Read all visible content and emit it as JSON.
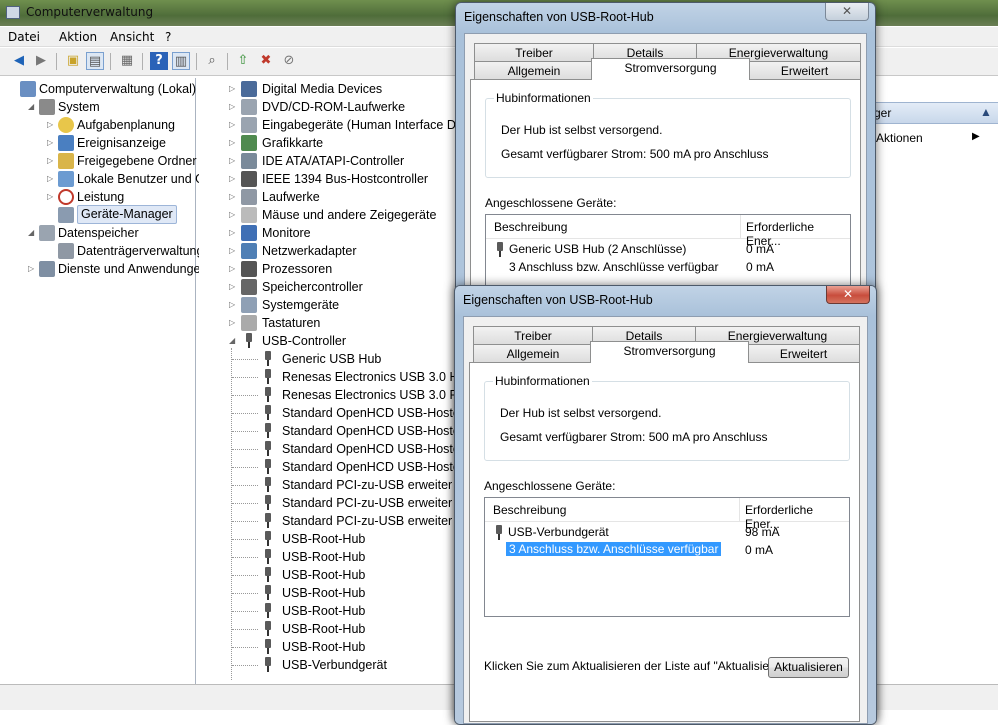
{
  "main": {
    "title": "Computerverwaltung",
    "menu": [
      "Datei",
      "Aktion",
      "Ansicht",
      "?"
    ],
    "left_tree": [
      {
        "label": "Computerverwaltung (Lokal)",
        "icon": "computer-icon",
        "indent": 0,
        "arrow": ""
      },
      {
        "label": "System",
        "icon": "tools-icon",
        "indent": 1,
        "arrow": "open"
      },
      {
        "label": "Aufgabenplanung",
        "icon": "clock-icon",
        "indent": 2,
        "arrow": "closed"
      },
      {
        "label": "Ereignisanzeige",
        "icon": "event-viewer-icon",
        "indent": 2,
        "arrow": "closed"
      },
      {
        "label": "Freigegebene Ordner",
        "icon": "shared-folder-icon",
        "indent": 2,
        "arrow": "closed"
      },
      {
        "label": "Lokale Benutzer und Gr",
        "icon": "users-icon",
        "indent": 2,
        "arrow": "closed"
      },
      {
        "label": "Leistung",
        "icon": "performance-icon",
        "indent": 2,
        "arrow": "closed"
      },
      {
        "label": "Geräte-Manager",
        "icon": "device-manager-icon",
        "indent": 2,
        "arrow": "",
        "selected": true
      },
      {
        "label": "Datenspeicher",
        "icon": "storage-icon",
        "indent": 1,
        "arrow": "open"
      },
      {
        "label": "Datenträgerverwaltung",
        "icon": "disk-icon",
        "indent": 2,
        "arrow": ""
      },
      {
        "label": "Dienste und Anwendungen",
        "icon": "services-icon",
        "indent": 1,
        "arrow": "closed"
      }
    ],
    "device_tree": [
      {
        "label": "Digital Media Devices",
        "icon": "media-icon",
        "indent": 0
      },
      {
        "label": "DVD/CD-ROM-Laufwerke",
        "icon": "dvd-icon",
        "indent": 0
      },
      {
        "label": "Eingabegeräte (Human Interface Devi",
        "icon": "hid-icon",
        "indent": 0
      },
      {
        "label": "Grafikkarte",
        "icon": "display-adapter-icon",
        "indent": 0
      },
      {
        "label": "IDE ATA/ATAPI-Controller",
        "icon": "ide-icon",
        "indent": 0
      },
      {
        "label": "IEEE 1394 Bus-Hostcontroller",
        "icon": "firewire-icon",
        "indent": 0
      },
      {
        "label": "Laufwerke",
        "icon": "drive-icon",
        "indent": 0
      },
      {
        "label": "Mäuse und andere Zeigegeräte",
        "icon": "mouse-icon",
        "indent": 0
      },
      {
        "label": "Monitore",
        "icon": "monitor-icon",
        "indent": 0
      },
      {
        "label": "Netzwerkadapter",
        "icon": "network-icon",
        "indent": 0
      },
      {
        "label": "Prozessoren",
        "icon": "cpu-icon",
        "indent": 0
      },
      {
        "label": "Speichercontroller",
        "icon": "storage-controller-icon",
        "indent": 0
      },
      {
        "label": "Systemgeräte",
        "icon": "system-device-icon",
        "indent": 0
      },
      {
        "label": "Tastaturen",
        "icon": "keyboard-icon",
        "indent": 0
      },
      {
        "label": "USB-Controller",
        "icon": "usb-icon",
        "indent": 0,
        "open": true
      },
      {
        "label": "Generic USB Hub",
        "icon": "usb-icon",
        "indent": 1
      },
      {
        "label": "Renesas Electronics USB 3.0 Host",
        "icon": "usb-icon",
        "indent": 1
      },
      {
        "label": "Renesas Electronics USB 3.0 Root",
        "icon": "usb-icon",
        "indent": 1
      },
      {
        "label": "Standard OpenHCD USB-Hostco",
        "icon": "usb-icon",
        "indent": 1
      },
      {
        "label": "Standard OpenHCD USB-Hostco",
        "icon": "usb-icon",
        "indent": 1
      },
      {
        "label": "Standard OpenHCD USB-Hostco",
        "icon": "usb-icon",
        "indent": 1
      },
      {
        "label": "Standard OpenHCD USB-Hostco",
        "icon": "usb-icon",
        "indent": 1
      },
      {
        "label": "Standard PCI-zu-USB erweiter",
        "icon": "usb-icon",
        "indent": 1
      },
      {
        "label": "Standard PCI-zu-USB erweiter",
        "icon": "usb-icon",
        "indent": 1
      },
      {
        "label": "Standard PCI-zu-USB erweiter",
        "icon": "usb-icon",
        "indent": 1
      },
      {
        "label": "USB-Root-Hub",
        "icon": "usb-icon",
        "indent": 1
      },
      {
        "label": "USB-Root-Hub",
        "icon": "usb-icon",
        "indent": 1
      },
      {
        "label": "USB-Root-Hub",
        "icon": "usb-icon",
        "indent": 1
      },
      {
        "label": "USB-Root-Hub",
        "icon": "usb-icon",
        "indent": 1
      },
      {
        "label": "USB-Root-Hub",
        "icon": "usb-icon",
        "indent": 1
      },
      {
        "label": "USB-Root-Hub",
        "icon": "usb-icon",
        "indent": 1
      },
      {
        "label": "USB-Root-Hub",
        "icon": "usb-icon",
        "indent": 1
      },
      {
        "label": "USB-Verbundgerät",
        "icon": "usb-icon",
        "indent": 1
      }
    ],
    "actions": {
      "header": "ger",
      "item": "Aktionen"
    }
  },
  "dialog1": {
    "title": "Eigenschaften von USB-Root-Hub",
    "tabs_back": [
      "Treiber",
      "Details",
      "Energieverwaltung"
    ],
    "tabs_front": [
      "Allgemein",
      "Stromversorgung",
      "Erweitert"
    ],
    "hub_group": "Hubinformationen",
    "hub_line1": "Der Hub ist selbst versorgend.",
    "hub_line2": "Gesamt verfügbarer Strom: 500 mA pro Anschluss",
    "devices_label": "Angeschlossene Geräte:",
    "col1": "Beschreibung",
    "col2": "Erforderliche Ener...",
    "rows": [
      {
        "desc": "Generic USB Hub (2 Anschlüsse)",
        "power": "0 mA",
        "icon": true
      },
      {
        "desc": "3 Anschluss bzw. Anschlüsse verfügbar",
        "power": "0 mA",
        "icon": false
      }
    ]
  },
  "dialog2": {
    "title": "Eigenschaften von USB-Root-Hub",
    "tabs_back": [
      "Treiber",
      "Details",
      "Energieverwaltung"
    ],
    "tabs_front": [
      "Allgemein",
      "Stromversorgung",
      "Erweitert"
    ],
    "hub_group": "Hubinformationen",
    "hub_line1": "Der Hub ist selbst versorgend.",
    "hub_line2": "Gesamt verfügbarer Strom: 500 mA pro Anschluss",
    "devices_label": "Angeschlossene Geräte:",
    "col1": "Beschreibung",
    "col2": "Erforderliche Ener...",
    "rows": [
      {
        "desc": "USB-Verbundgerät",
        "power": "98 mA",
        "icon": true
      },
      {
        "desc": "3 Anschluss bzw. Anschlüsse verfügbar",
        "power": "0 mA",
        "icon": false,
        "selected": true
      }
    ],
    "refresh_hint": "Klicken Sie zum Aktualisieren der Liste auf \"Aktualisieren\".",
    "refresh_button": "Aktualisieren"
  }
}
